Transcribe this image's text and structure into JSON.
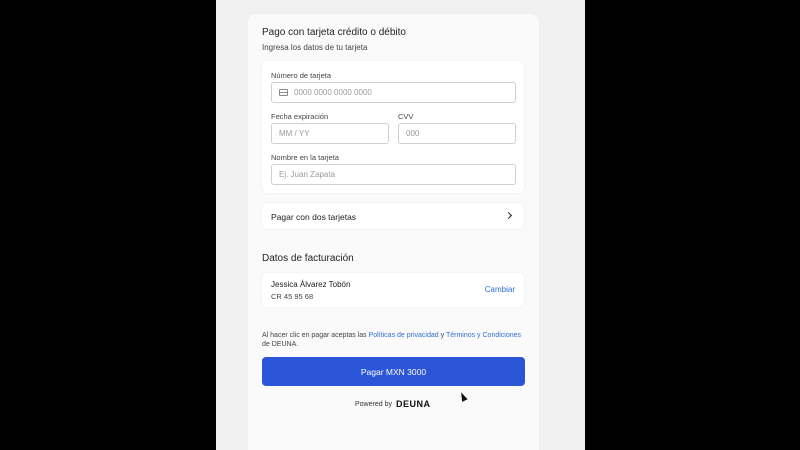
{
  "payment": {
    "title": "Pago con tarjeta crédito o débito",
    "subtitle": "Ingresa los datos de tu tarjeta",
    "card_number_label": "Número de tarjeta",
    "card_number_placeholder": "0000 0000 0000 0000",
    "expiry_label": "Fecha expiración",
    "expiry_placeholder": "MM / YY",
    "cvv_label": "CVV",
    "cvv_placeholder": "000",
    "name_label": "Nombre en la tarjeta",
    "name_placeholder": "Ej. Juan Zapata"
  },
  "two_cards": {
    "label": "Pagar con dos tarjetas"
  },
  "billing": {
    "title": "Datos de facturación",
    "name": "Jessica Álvarez Tobón",
    "id": "CR 45 95 68",
    "change_label": "Cambiar"
  },
  "terms": {
    "prefix": "Al hacer clic en pagar aceptas las ",
    "privacy_link": "Políticas de privacidad",
    "and": " y ",
    "terms_link": "Términos y Condiciones",
    "suffix": " de DEUNA."
  },
  "pay_button": {
    "label": "Pagar MXN 3000"
  },
  "footer": {
    "powered_by": "Powered by",
    "brand": "DEUNA"
  },
  "icons": {
    "card": "credit-card-icon",
    "info": "info-icon",
    "chevron": "chevron-right-icon",
    "cursor": "mouse-cursor-icon"
  }
}
